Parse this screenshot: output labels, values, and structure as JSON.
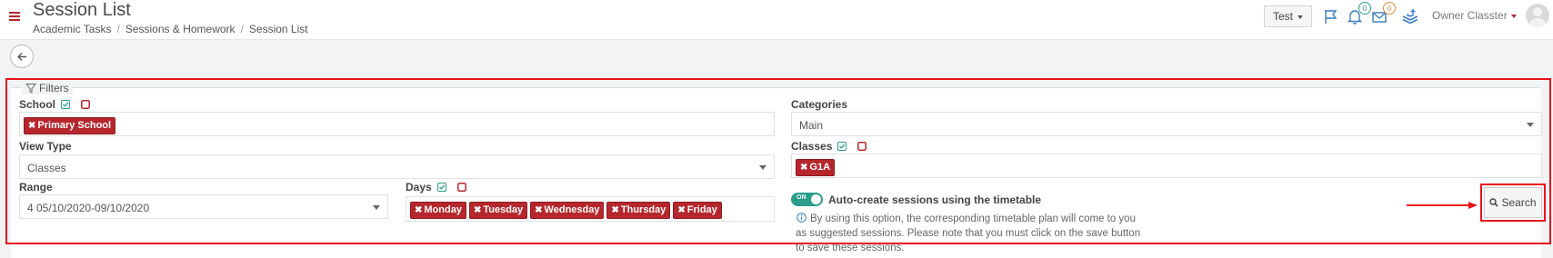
{
  "header": {
    "title": "Session List",
    "breadcrumb": [
      "Academic Tasks",
      "Sessions & Homework",
      "Session List"
    ],
    "test_dropdown": "Test",
    "notifications_count": "0",
    "messages_count": "0",
    "user_name": "Owner Classter"
  },
  "filters": {
    "legend": "Filters",
    "school": {
      "label": "School",
      "tags": [
        "Primary School"
      ]
    },
    "view_type": {
      "label": "View Type",
      "value": "Classes"
    },
    "range": {
      "label": "Range",
      "value": "4 05/10/2020-09/10/2020"
    },
    "days": {
      "label": "Days",
      "tags": [
        "Monday",
        "Tuesday",
        "Wednesday",
        "Thursday",
        "Friday"
      ]
    },
    "categories": {
      "label": "Categories",
      "value": "Main"
    },
    "classes": {
      "label": "Classes",
      "tags": [
        "G1A"
      ]
    },
    "auto_create": {
      "toggle_text": "ON",
      "label": "Auto-create sessions using the timetable",
      "help_lines": [
        "By using this option, the corresponding timetable plan will come to you",
        "as suggested sessions. Please note that you must click on the save button",
        "to save these sessions."
      ]
    },
    "search_label": "Search"
  },
  "colors": {
    "accent": "#b6272d",
    "highlight": "#e8141b",
    "toggle": "#2b9d8a"
  }
}
